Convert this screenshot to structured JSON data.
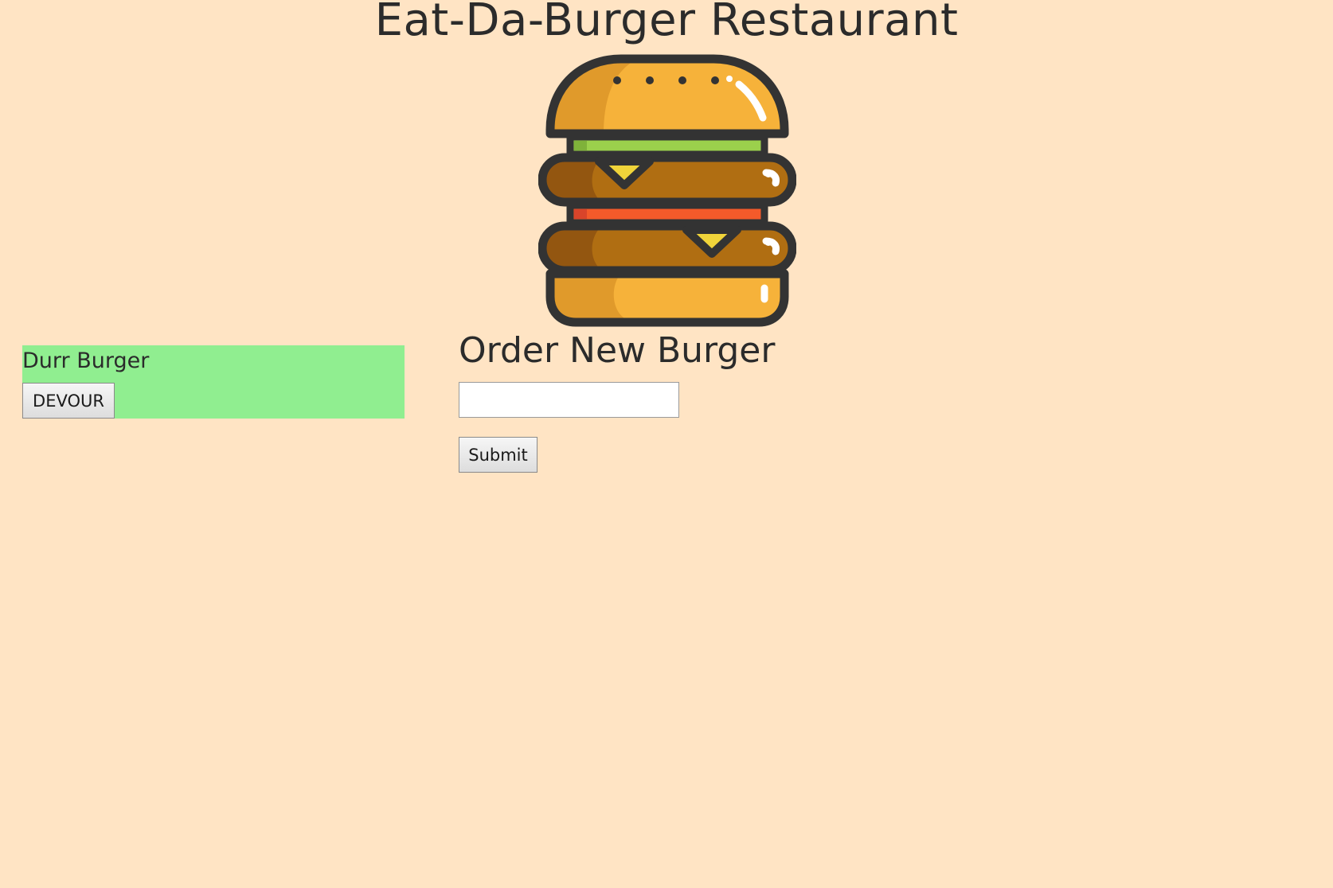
{
  "header": {
    "title": "Eat-Da-Burger Restaurant",
    "logo_icon": "burger-icon"
  },
  "burgers": [
    {
      "name": "Durr Burger",
      "button_label": "DEVOUR",
      "background": "#90ee90"
    }
  ],
  "order_form": {
    "heading": "Order New Burger",
    "input_value": "",
    "input_placeholder": "",
    "submit_label": "Submit"
  },
  "colors": {
    "page_background": "#ffe4c4",
    "text": "#2b2b2b",
    "burger_card": "#90ee90"
  }
}
